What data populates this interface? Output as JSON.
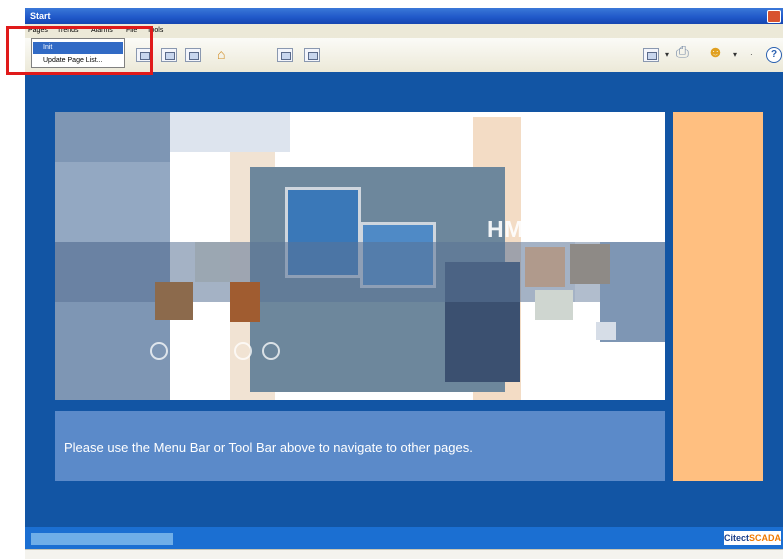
{
  "window": {
    "title": "Start"
  },
  "menubar": {
    "items": [
      "Pages",
      "Trends",
      "Alarms",
      "File",
      "Tools"
    ]
  },
  "dropdown": {
    "items": [
      {
        "label": "Init",
        "selected": true
      },
      {
        "label": "Update Page List...",
        "selected": false
      }
    ]
  },
  "toolbar": {
    "icons": [
      "page-icon",
      "page-icon",
      "page-icon",
      "home-icon",
      "page-icon",
      "page-icon",
      "report-icon",
      "print-icon",
      "users-icon",
      "help-icon"
    ]
  },
  "banner": {
    "heading": "HMI/SCADA"
  },
  "message": {
    "text": "Please use the Menu Bar or Tool Bar above to navigate to other pages."
  },
  "statusbar": {
    "logo_part1": "Citect",
    "logo_part2": "SCADA"
  },
  "colors": {
    "main_background": "#1255a4",
    "message_panel": "#5b8ac9",
    "side_panel": "#ffbf80",
    "highlight": "#e01a1a"
  }
}
